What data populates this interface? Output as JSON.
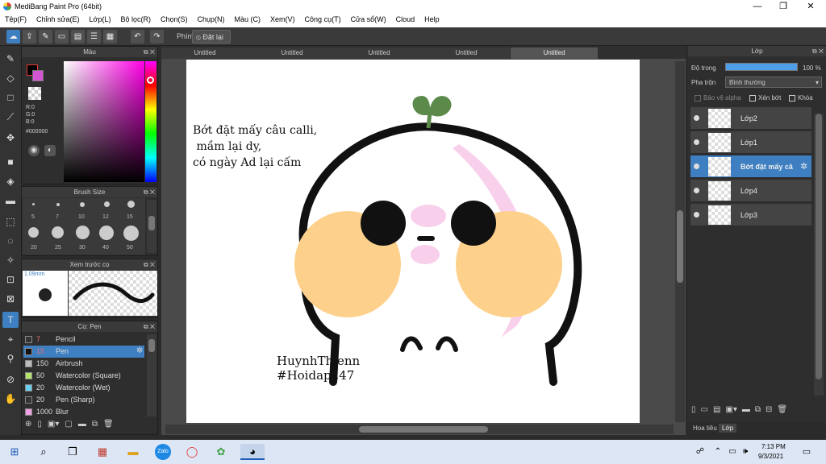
{
  "window": {
    "title": "MediBang Paint Pro (64bit)",
    "min": "—",
    "max": "❐",
    "close": "✕"
  },
  "menu": [
    "Tệp(F)",
    "Chỉnh sửa(E)",
    "Lớp(L)",
    "Bộ lọc(R)",
    "Chọn(S)",
    "Chụp(N)",
    "Màu (C)",
    "Xem(V)",
    "Công cụ(T)",
    "Cửa sổ(W)",
    "Cloud",
    "Help"
  ],
  "toolbar": {
    "phim_label": "Phím",
    "reset_label": "Đặt lại"
  },
  "color_panel": {
    "title": "Màu",
    "r": "R:0",
    "g": "G:0",
    "b": "B:0",
    "hex": "#000000"
  },
  "brush_size_panel": {
    "title": "Brush Size",
    "sizes": [
      "5",
      "7",
      "10",
      "12",
      "15",
      "20",
      "25",
      "30",
      "40",
      "50"
    ]
  },
  "preview_panel": {
    "title": "Xem trước cọ",
    "size": "1.09mm"
  },
  "brush_panel": {
    "title": "Cọ: Pen",
    "items": [
      {
        "size": "7",
        "name": "Pencil",
        "color": "#333333"
      },
      {
        "size": "15",
        "name": "Pen",
        "color": "#111111"
      },
      {
        "size": "150",
        "name": "Airbrush",
        "color": "#bbbbbb"
      },
      {
        "size": "50",
        "name": "Watercolor (Square)",
        "color": "#b6e36b"
      },
      {
        "size": "20",
        "name": "Watercolor (Wet)",
        "color": "#6ad0f0"
      },
      {
        "size": "20",
        "name": "Pen (Sharp)",
        "color": "#333333"
      },
      {
        "size": "1000",
        "name": "Blur",
        "color": "#f0a0e0"
      }
    ]
  },
  "tabs": [
    "Untitled",
    "Untitled",
    "Untitled",
    "Untitled",
    "Untitled"
  ],
  "canvas": {
    "text_lines": [
      "Bớt đặt mấy câu calli,",
      " mầm lại dy,",
      "có ngày Ad lại cấm"
    ],
    "signature": [
      "HuynhThienn",
      "#Hoidap247"
    ]
  },
  "layers_panel": {
    "title": "Lớp",
    "opacity_label": "Độ trong",
    "opacity_value": "100 %",
    "blend_label": "Pha trộn",
    "blend_value": "Bình thường",
    "protect_alpha": "Bảo vệ alpha",
    "clip": "Xén bớt",
    "lock": "Khóa",
    "layers": [
      {
        "name": "Lớp2",
        "selected": false
      },
      {
        "name": "Lớp1",
        "selected": false
      },
      {
        "name": "Bớt đặt mấy câ",
        "selected": true
      },
      {
        "name": "Lớp4",
        "selected": false
      },
      {
        "name": "Lớp3",
        "selected": false
      }
    ],
    "bottom_tabs": [
      "Hoa tiêu",
      "Lớp"
    ]
  },
  "taskbar": {
    "time": "7:13 PM",
    "date": "9/3/2021"
  },
  "colors": {
    "accent": "#3d7fc1",
    "cheek": "#fdd18b",
    "blush": "#f8d0ec",
    "sprout": "#5b8a4a"
  }
}
